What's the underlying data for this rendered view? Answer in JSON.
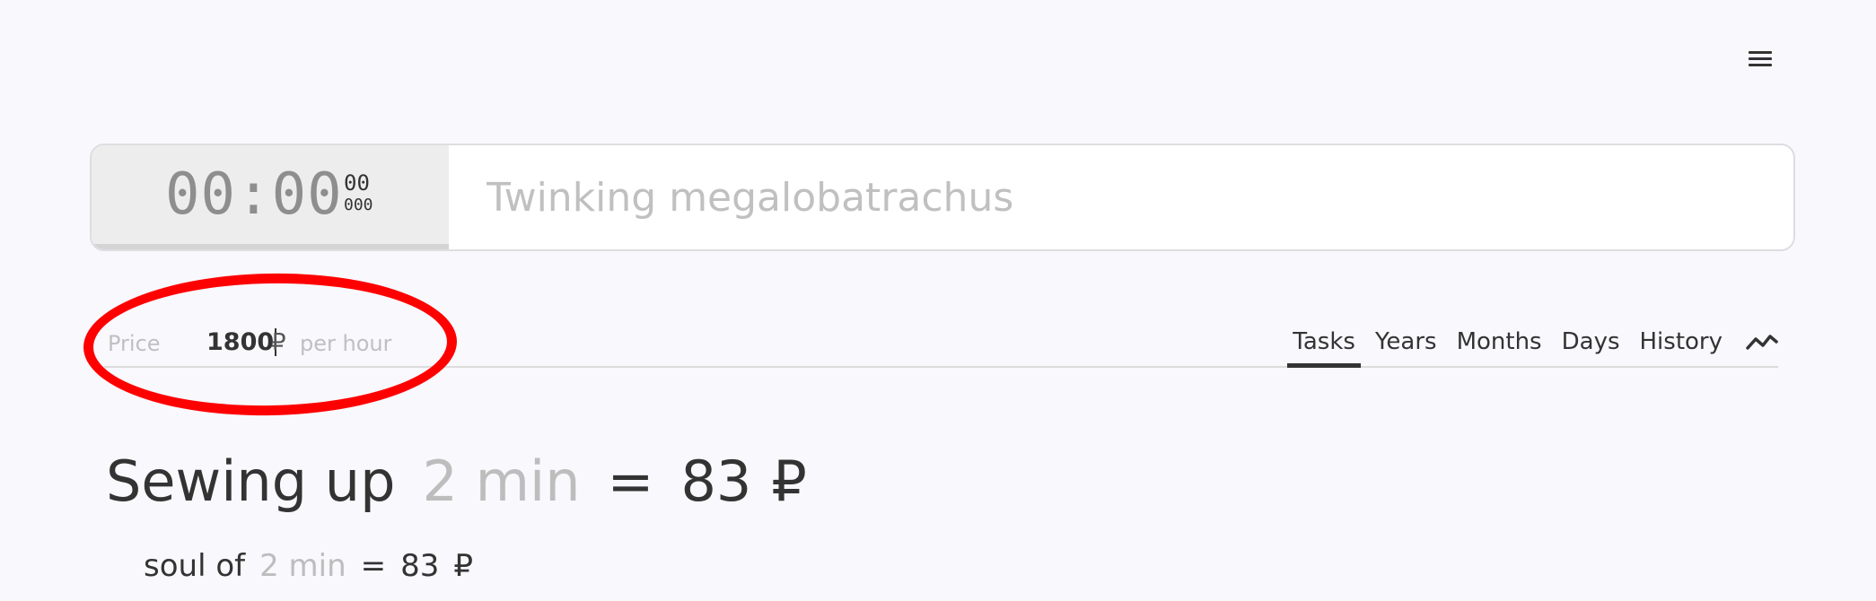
{
  "header": {
    "menu_icon": "hamburger-menu-icon"
  },
  "timer": {
    "time": "00:00",
    "seconds": "00",
    "milliseconds": "000"
  },
  "task_input": {
    "value": "",
    "placeholder": "Twinking megalobatrachus"
  },
  "price": {
    "label": "Price",
    "value": "1800",
    "currency": "₽",
    "unit": "per hour"
  },
  "tabs": [
    {
      "label": "Tasks",
      "active": true
    },
    {
      "label": "Years",
      "active": false
    },
    {
      "label": "Months",
      "active": false
    },
    {
      "label": "Days",
      "active": false
    },
    {
      "label": "History",
      "active": false
    }
  ],
  "chart_icon": "line-chart-icon",
  "summary": {
    "task": "Sewing up",
    "duration": "2 min",
    "equals": "=",
    "amount": "83",
    "currency": "₽"
  },
  "detail": {
    "task": "soul of",
    "duration": "2 min",
    "equals": "=",
    "amount": "83",
    "currency": "₽"
  },
  "annotation": {
    "color": "#ff0000"
  }
}
